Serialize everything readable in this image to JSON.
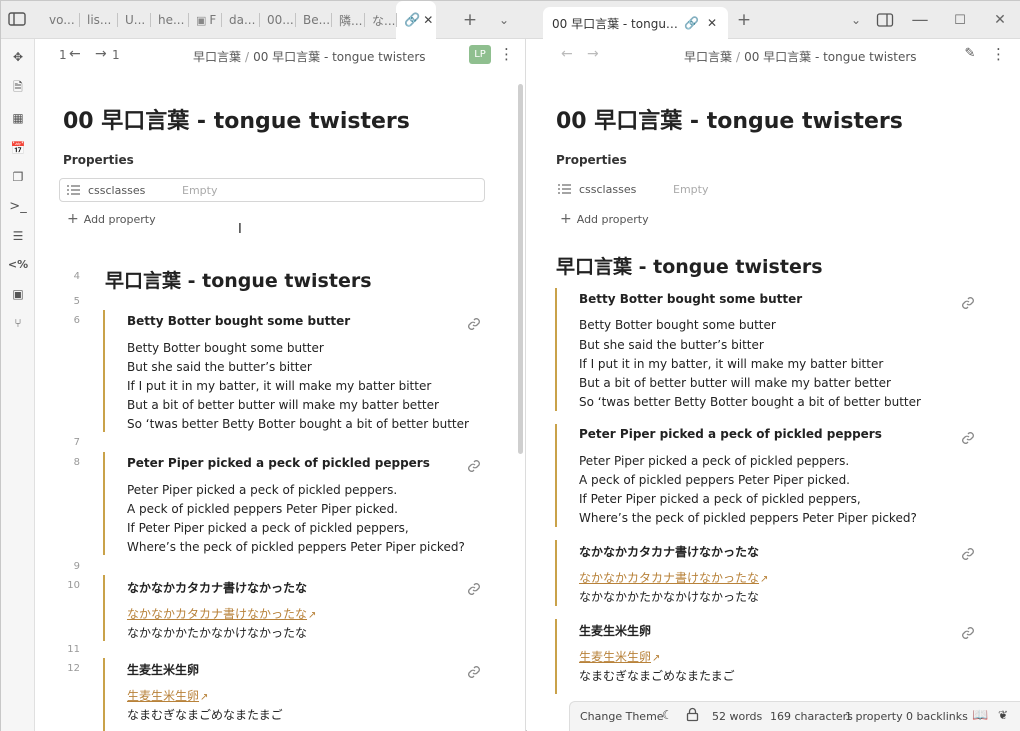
{
  "left_tabs": [
    {
      "label": "vo...",
      "icon": ""
    },
    {
      "label": "lis...",
      "icon": ""
    },
    {
      "label": "U...",
      "icon": ""
    },
    {
      "label": "he...",
      "icon": ""
    },
    {
      "label": "F",
      "icon": "pdf-file-icon"
    },
    {
      "label": "da...",
      "icon": ""
    },
    {
      "label": "00...",
      "icon": ""
    },
    {
      "label": "Be...",
      "icon": ""
    },
    {
      "label": "隣...",
      "icon": ""
    },
    {
      "label": "な...",
      "icon": ""
    }
  ],
  "right_tab": {
    "label": "00 早口言葉 - tongue t..."
  },
  "left_pane": {
    "back_count": "1",
    "forward_count": "1",
    "breadcrumb_folder": "早口言葉",
    "breadcrumb_file": "00 早口言葉 - tongue twisters",
    "mode_badge": "LP"
  },
  "right_pane": {
    "breadcrumb_folder": "早口言葉",
    "breadcrumb_file": "00 早口言葉 - tongue twisters"
  },
  "note": {
    "title": "00 早口言葉 - tongue twisters",
    "properties_label": "Properties",
    "property_key": "cssclasses",
    "property_value_placeholder": "Empty",
    "add_property_label": "Add property",
    "heading": "早口言葉 - tongue twisters",
    "callouts": [
      {
        "title": "Betty Botter bought some butter",
        "lines": [
          "Betty Botter bought some butter",
          "But she said the butter’s bitter",
          "If I put it in my batter, it will make my batter bitter",
          "But a bit of better butter will make my batter better",
          "So ‘twas better Betty Botter bought a bit of better butter"
        ]
      },
      {
        "title": "Peter Piper picked a peck of pickled peppers",
        "lines": [
          "Peter Piper picked a peck of pickled peppers.",
          "A peck of pickled peppers Peter Piper picked.",
          "If Peter Piper picked a peck of pickled peppers,",
          "Where’s the peck of pickled peppers Peter Piper picked?"
        ]
      },
      {
        "title": "なかなかカタカナ書けなかったな",
        "link": "なかなかカタカナ書けなかったな",
        "lines": [
          "なかなかかたかなかけなかったな"
        ]
      },
      {
        "title": "生麦生米生卵",
        "link": "生麦生米生卵",
        "lines": [
          "なまむぎなまごめなまたまご"
        ]
      }
    ],
    "line_numbers": [
      "4",
      "5",
      "6",
      "7",
      "8",
      "9",
      "10",
      "11",
      "12"
    ]
  },
  "status_bar": {
    "change_theme": "Change Theme",
    "words": "52 words",
    "characters": "169 characters",
    "properties": "1 property",
    "backlinks": "0 backlinks"
  },
  "colors": {
    "accent": "#c9a24a",
    "link": "#b8823a",
    "badge": "#8fbf8f"
  }
}
